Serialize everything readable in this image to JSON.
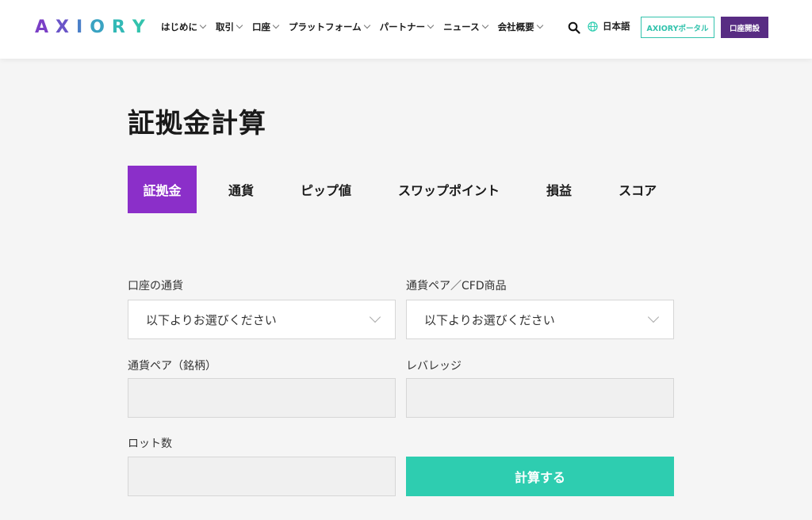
{
  "header": {
    "logo_letters": [
      "A",
      "X",
      "I",
      "O",
      "R",
      "Y"
    ],
    "logo_colors": [
      "#7b3fc6",
      "#6a55c8",
      "#4a7fc8",
      "#3aa3c2",
      "#33b9b6",
      "#33c3ad"
    ],
    "nav": [
      "はじめに",
      "取引",
      "口座",
      "プラットフォーム",
      "パートナー",
      "ニュース",
      "会社概要"
    ],
    "language": "日本語",
    "portal_label": "AXIORYポータル",
    "open_account_label": "口座開設"
  },
  "main": {
    "title": "証拠金計算",
    "tabs": [
      "証拠金",
      "通貨",
      "ピップ値",
      "スワップポイント",
      "損益",
      "スコア"
    ],
    "active_tab": 0,
    "form": {
      "account_currency_label": "口座の通貨",
      "account_currency_value": "以下よりお選びください",
      "pair_label": "通貨ペア／CFD商品",
      "pair_value": "以下よりお選びください",
      "symbol_label": "通貨ペア（銘柄）",
      "symbol_value": "",
      "leverage_label": "レバレッジ",
      "leverage_value": "",
      "lots_label": "ロット数",
      "lots_value": "",
      "calculate_label": "計算する"
    }
  },
  "colors": {
    "brand_purple": "#582c83",
    "tab_active": "#8b2fc9",
    "accent_teal": "#2ecdb0"
  }
}
